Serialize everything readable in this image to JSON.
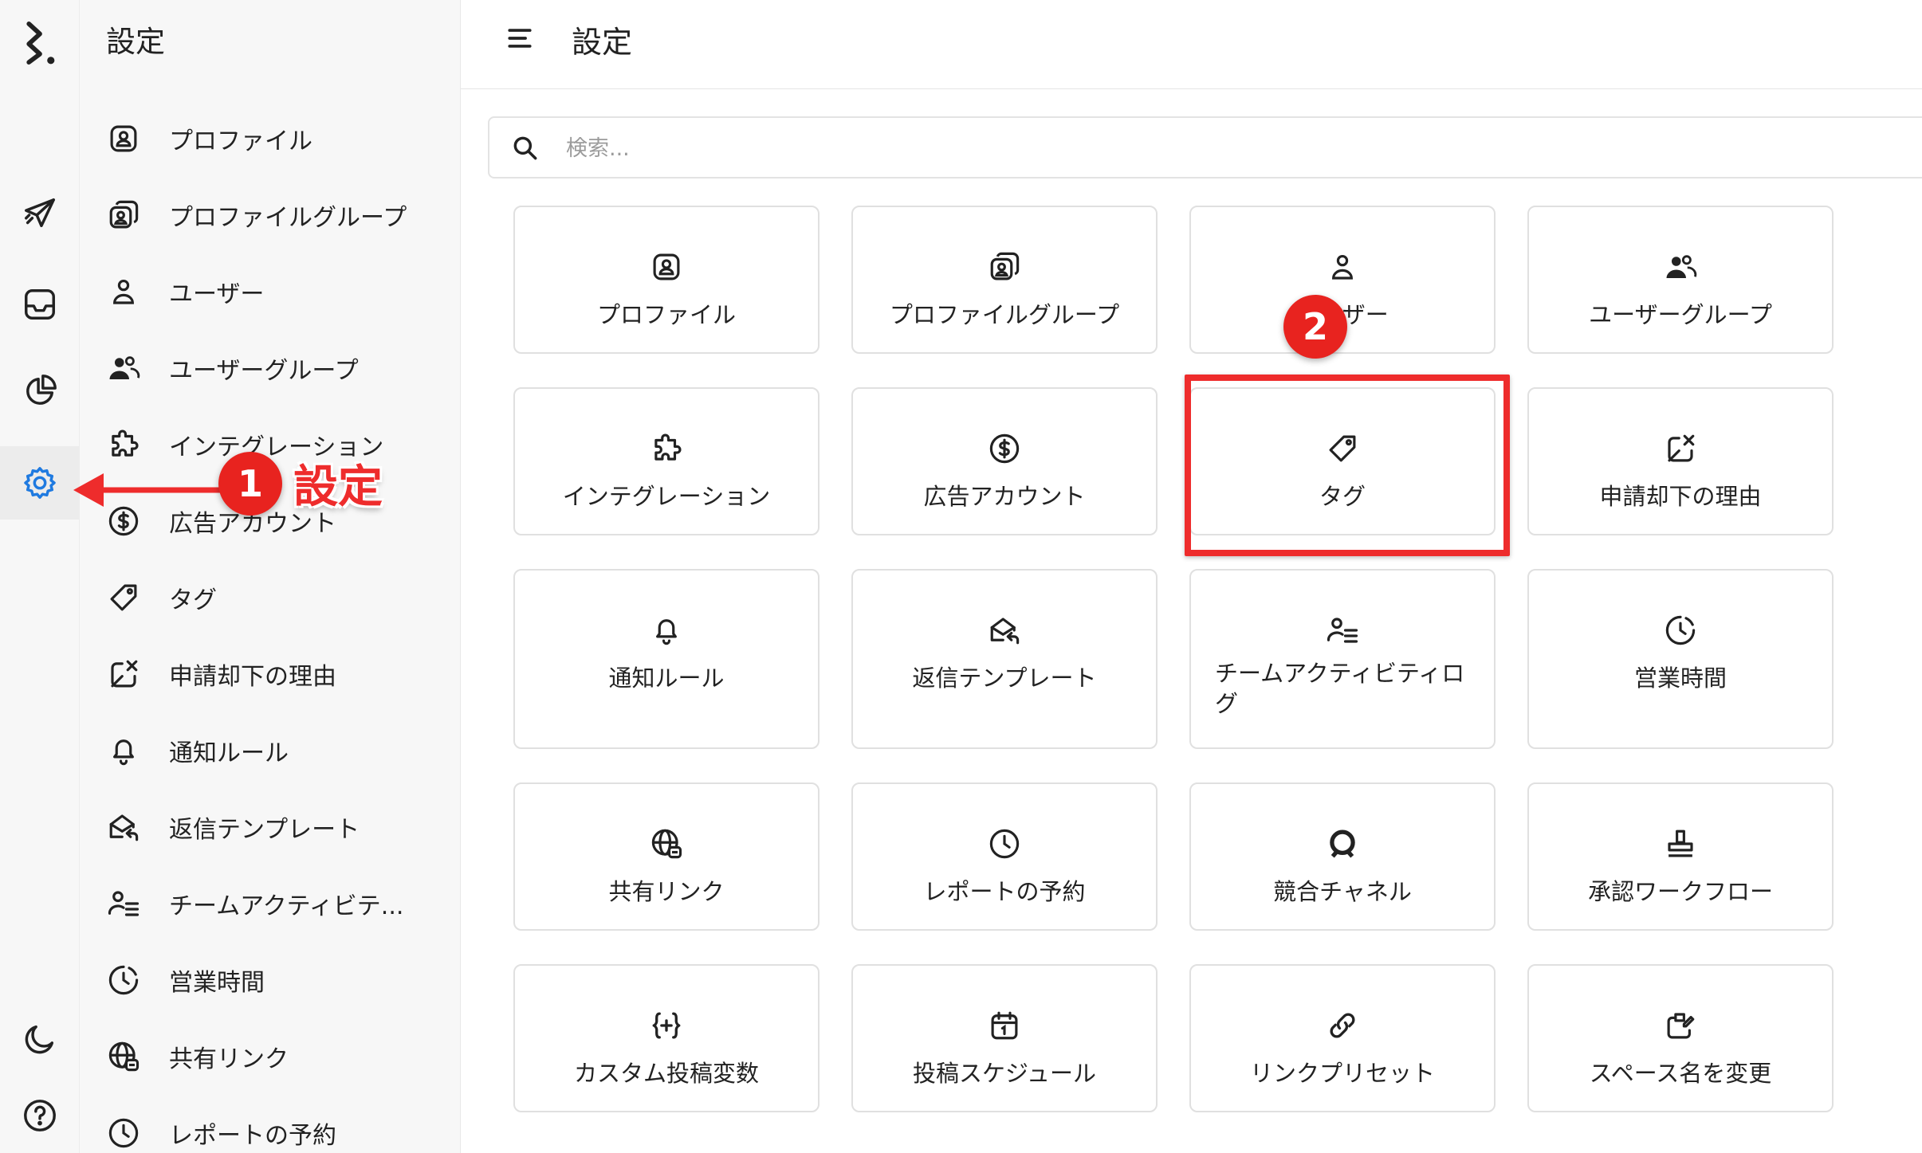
{
  "rail": {
    "items": [
      {
        "name": "logo",
        "icon": "brand-logo-icon"
      },
      {
        "name": "publish",
        "icon": "paper-plane-icon"
      },
      {
        "name": "inbox",
        "icon": "inbox-tray-icon"
      },
      {
        "name": "analytics",
        "icon": "pie-chart-icon"
      },
      {
        "name": "settings",
        "icon": "gear-icon",
        "active": true
      },
      {
        "name": "theme",
        "icon": "moon-icon"
      },
      {
        "name": "help",
        "icon": "question-circle-icon"
      }
    ],
    "active_color": "#1f7ae0"
  },
  "nav": {
    "title": "設定",
    "items": [
      {
        "label": "プロファイル",
        "icon": "profile-icon"
      },
      {
        "label": "プロファイルグループ",
        "icon": "profile-group-icon"
      },
      {
        "label": "ユーザー",
        "icon": "user-icon"
      },
      {
        "label": "ユーザーグループ",
        "icon": "user-group-icon"
      },
      {
        "label": "インテグレーション",
        "icon": "puzzle-icon"
      },
      {
        "label": "広告アカウント",
        "icon": "dollar-circle-icon"
      },
      {
        "label": "タグ",
        "icon": "tag-icon"
      },
      {
        "label": "申請却下の理由",
        "icon": "reject-icon"
      },
      {
        "label": "通知ルール",
        "icon": "bell-icon"
      },
      {
        "label": "返信テンプレート",
        "icon": "reply-mail-icon"
      },
      {
        "label": "チームアクティビテ...",
        "icon": "team-activity-icon"
      },
      {
        "label": "営業時間",
        "icon": "moon-clock-icon"
      },
      {
        "label": "共有リンク",
        "icon": "globe-link-icon"
      },
      {
        "label": "レポートの予約",
        "icon": "clock-icon"
      }
    ]
  },
  "header": {
    "title": "設定",
    "menu_icon": "menu-icon"
  },
  "search": {
    "placeholder": "検索...",
    "value": "",
    "icon": "search-icon"
  },
  "cards": [
    {
      "label": "プロファイル",
      "icon": "profile-icon"
    },
    {
      "label": "プロファイルグループ",
      "icon": "profile-group-icon"
    },
    {
      "label": "ユーザー",
      "icon": "user-icon"
    },
    {
      "label": "ユーザーグループ",
      "icon": "user-group-icon"
    },
    {
      "label": "インテグレーション",
      "icon": "puzzle-icon"
    },
    {
      "label": "広告アカウント",
      "icon": "dollar-circle-icon"
    },
    {
      "label": "タグ",
      "icon": "tag-icon"
    },
    {
      "label": "申請却下の理由",
      "icon": "reject-icon"
    },
    {
      "label": "通知ルール",
      "icon": "bell-icon"
    },
    {
      "label": "返信テンプレート",
      "icon": "reply-mail-icon"
    },
    {
      "label": "チームアクティビティログ",
      "icon": "team-activity-icon"
    },
    {
      "label": "営業時間",
      "icon": "moon-clock-icon"
    },
    {
      "label": "共有リンク",
      "icon": "globe-link-icon"
    },
    {
      "label": "レポートの予約",
      "icon": "clock-icon"
    },
    {
      "label": "競合チャネル",
      "icon": "competitor-icon"
    },
    {
      "label": "承認ワークフロー",
      "icon": "stamp-icon"
    },
    {
      "label": "カスタム投稿変数",
      "icon": "variable-braces-icon"
    },
    {
      "label": "投稿スケジュール",
      "icon": "calendar-icon"
    },
    {
      "label": "リンクプリセット",
      "icon": "link-icon"
    },
    {
      "label": "スペース名を変更",
      "icon": "rename-icon"
    }
  ],
  "annotations": {
    "step1": {
      "number": "1",
      "text": "設定"
    },
    "step2": {
      "number": "2"
    },
    "color": "#ee2c2c"
  }
}
